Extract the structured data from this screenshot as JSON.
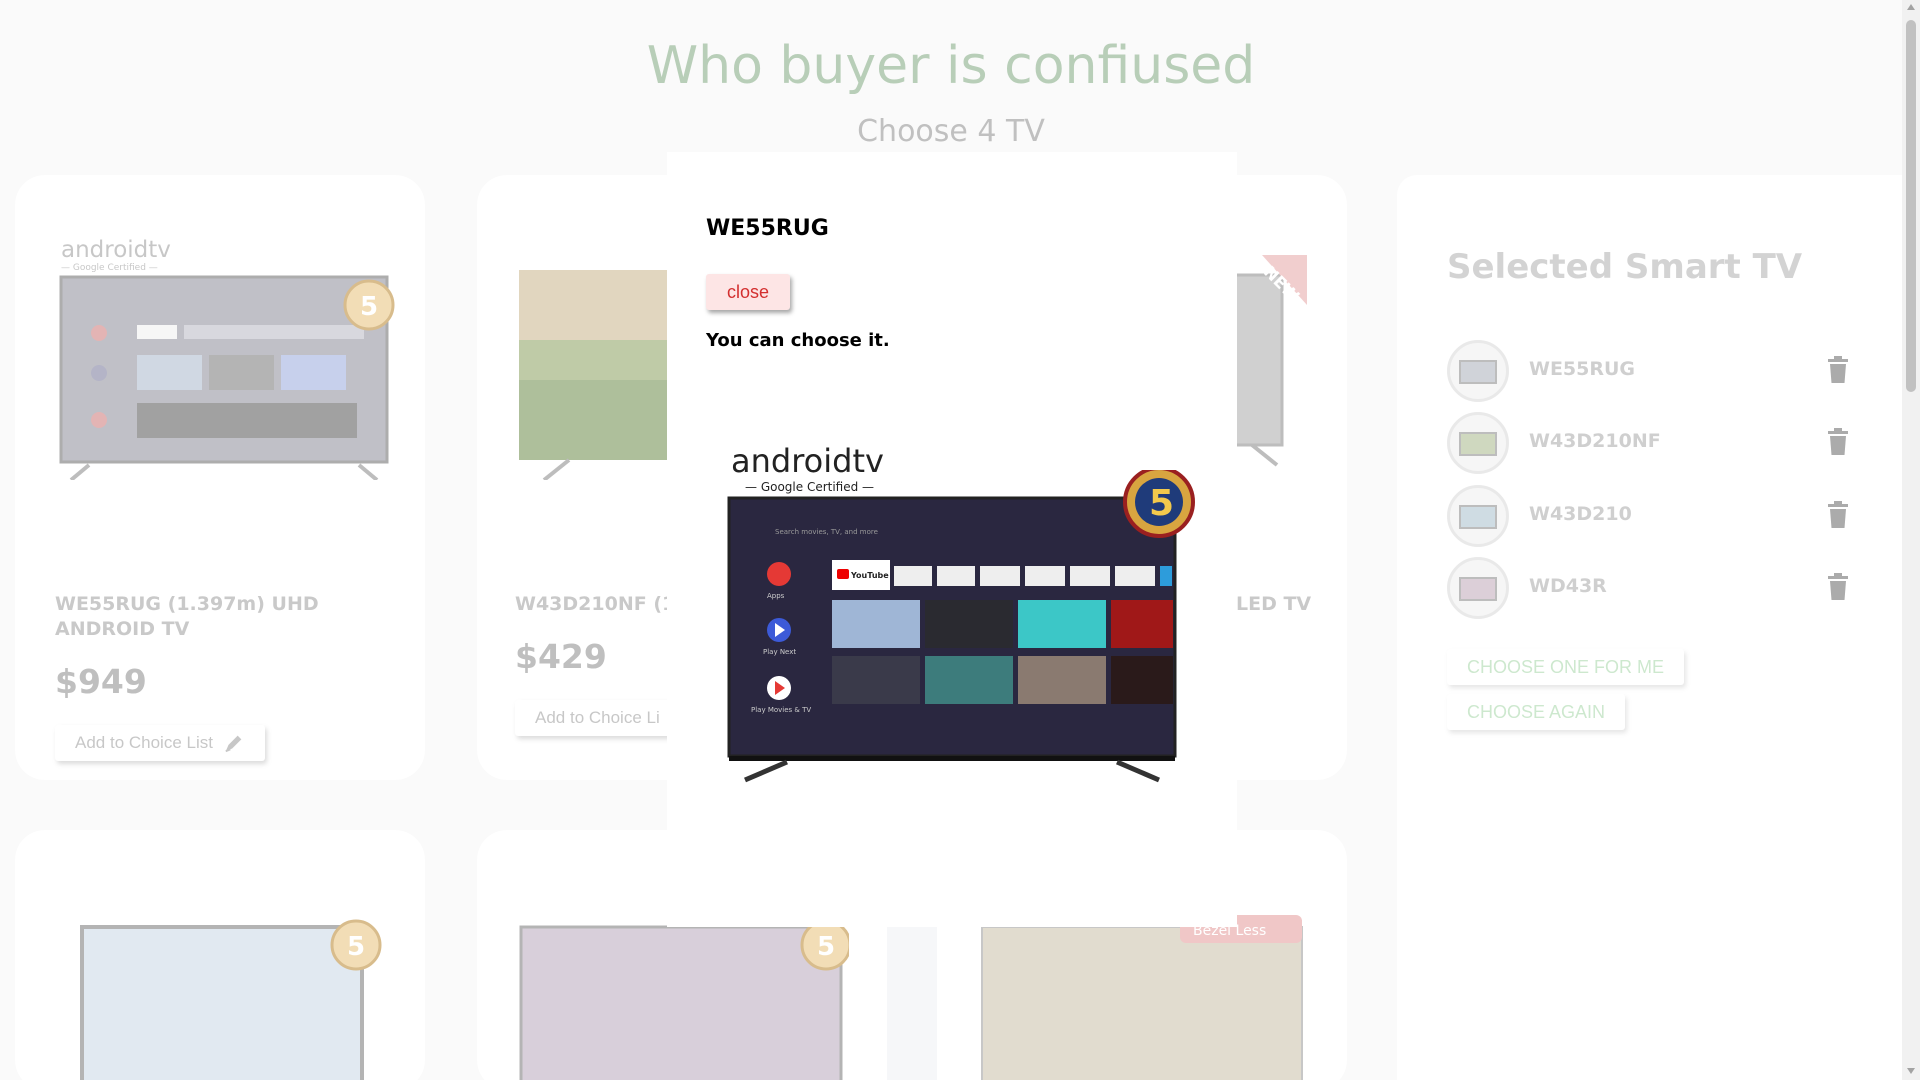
{
  "header": {
    "title": "Who buyer is confiused",
    "subtitle": "Choose 4 TV"
  },
  "products": [
    {
      "name": "WE55RUG (1.397m) UHD ANDROID TV",
      "price": "$949",
      "button": "Add to Choice List",
      "brand": "androidtv",
      "brand_sub": "— Google Certified —",
      "badge": "5"
    },
    {
      "name": "W43D210NF (1.0",
      "price": "$429",
      "button": "Add to Choice Li"
    },
    {
      "name": "LED TV",
      "badge": "NEW"
    },
    {
      "badge": "5"
    },
    {
      "badge": "5"
    },
    {
      "badge": "Bezel Less"
    }
  ],
  "side_panel": {
    "title": "Selected Smart TV",
    "items": [
      {
        "label": "WE55RUG"
      },
      {
        "label": "W43D210NF"
      },
      {
        "label": "W43D210"
      },
      {
        "label": "WD43R"
      }
    ],
    "choose_one_label": "CHOOSE ONE FOR ME",
    "choose_again_label": "CHOOSE AGAIN"
  },
  "modal": {
    "title": "WE55RUG",
    "close_label": "close",
    "message": "You can choose it.",
    "brand": "androidtv",
    "brand_sub": "— Google Certified —",
    "badge": "5",
    "apps": [
      "YouTube",
      "Apps",
      "Play Next",
      "Play Movies & TV"
    ]
  },
  "colors": {
    "title": "#7fa77f",
    "close_text": "#d32f2f",
    "choose_button_text": "#a5d6a7"
  }
}
